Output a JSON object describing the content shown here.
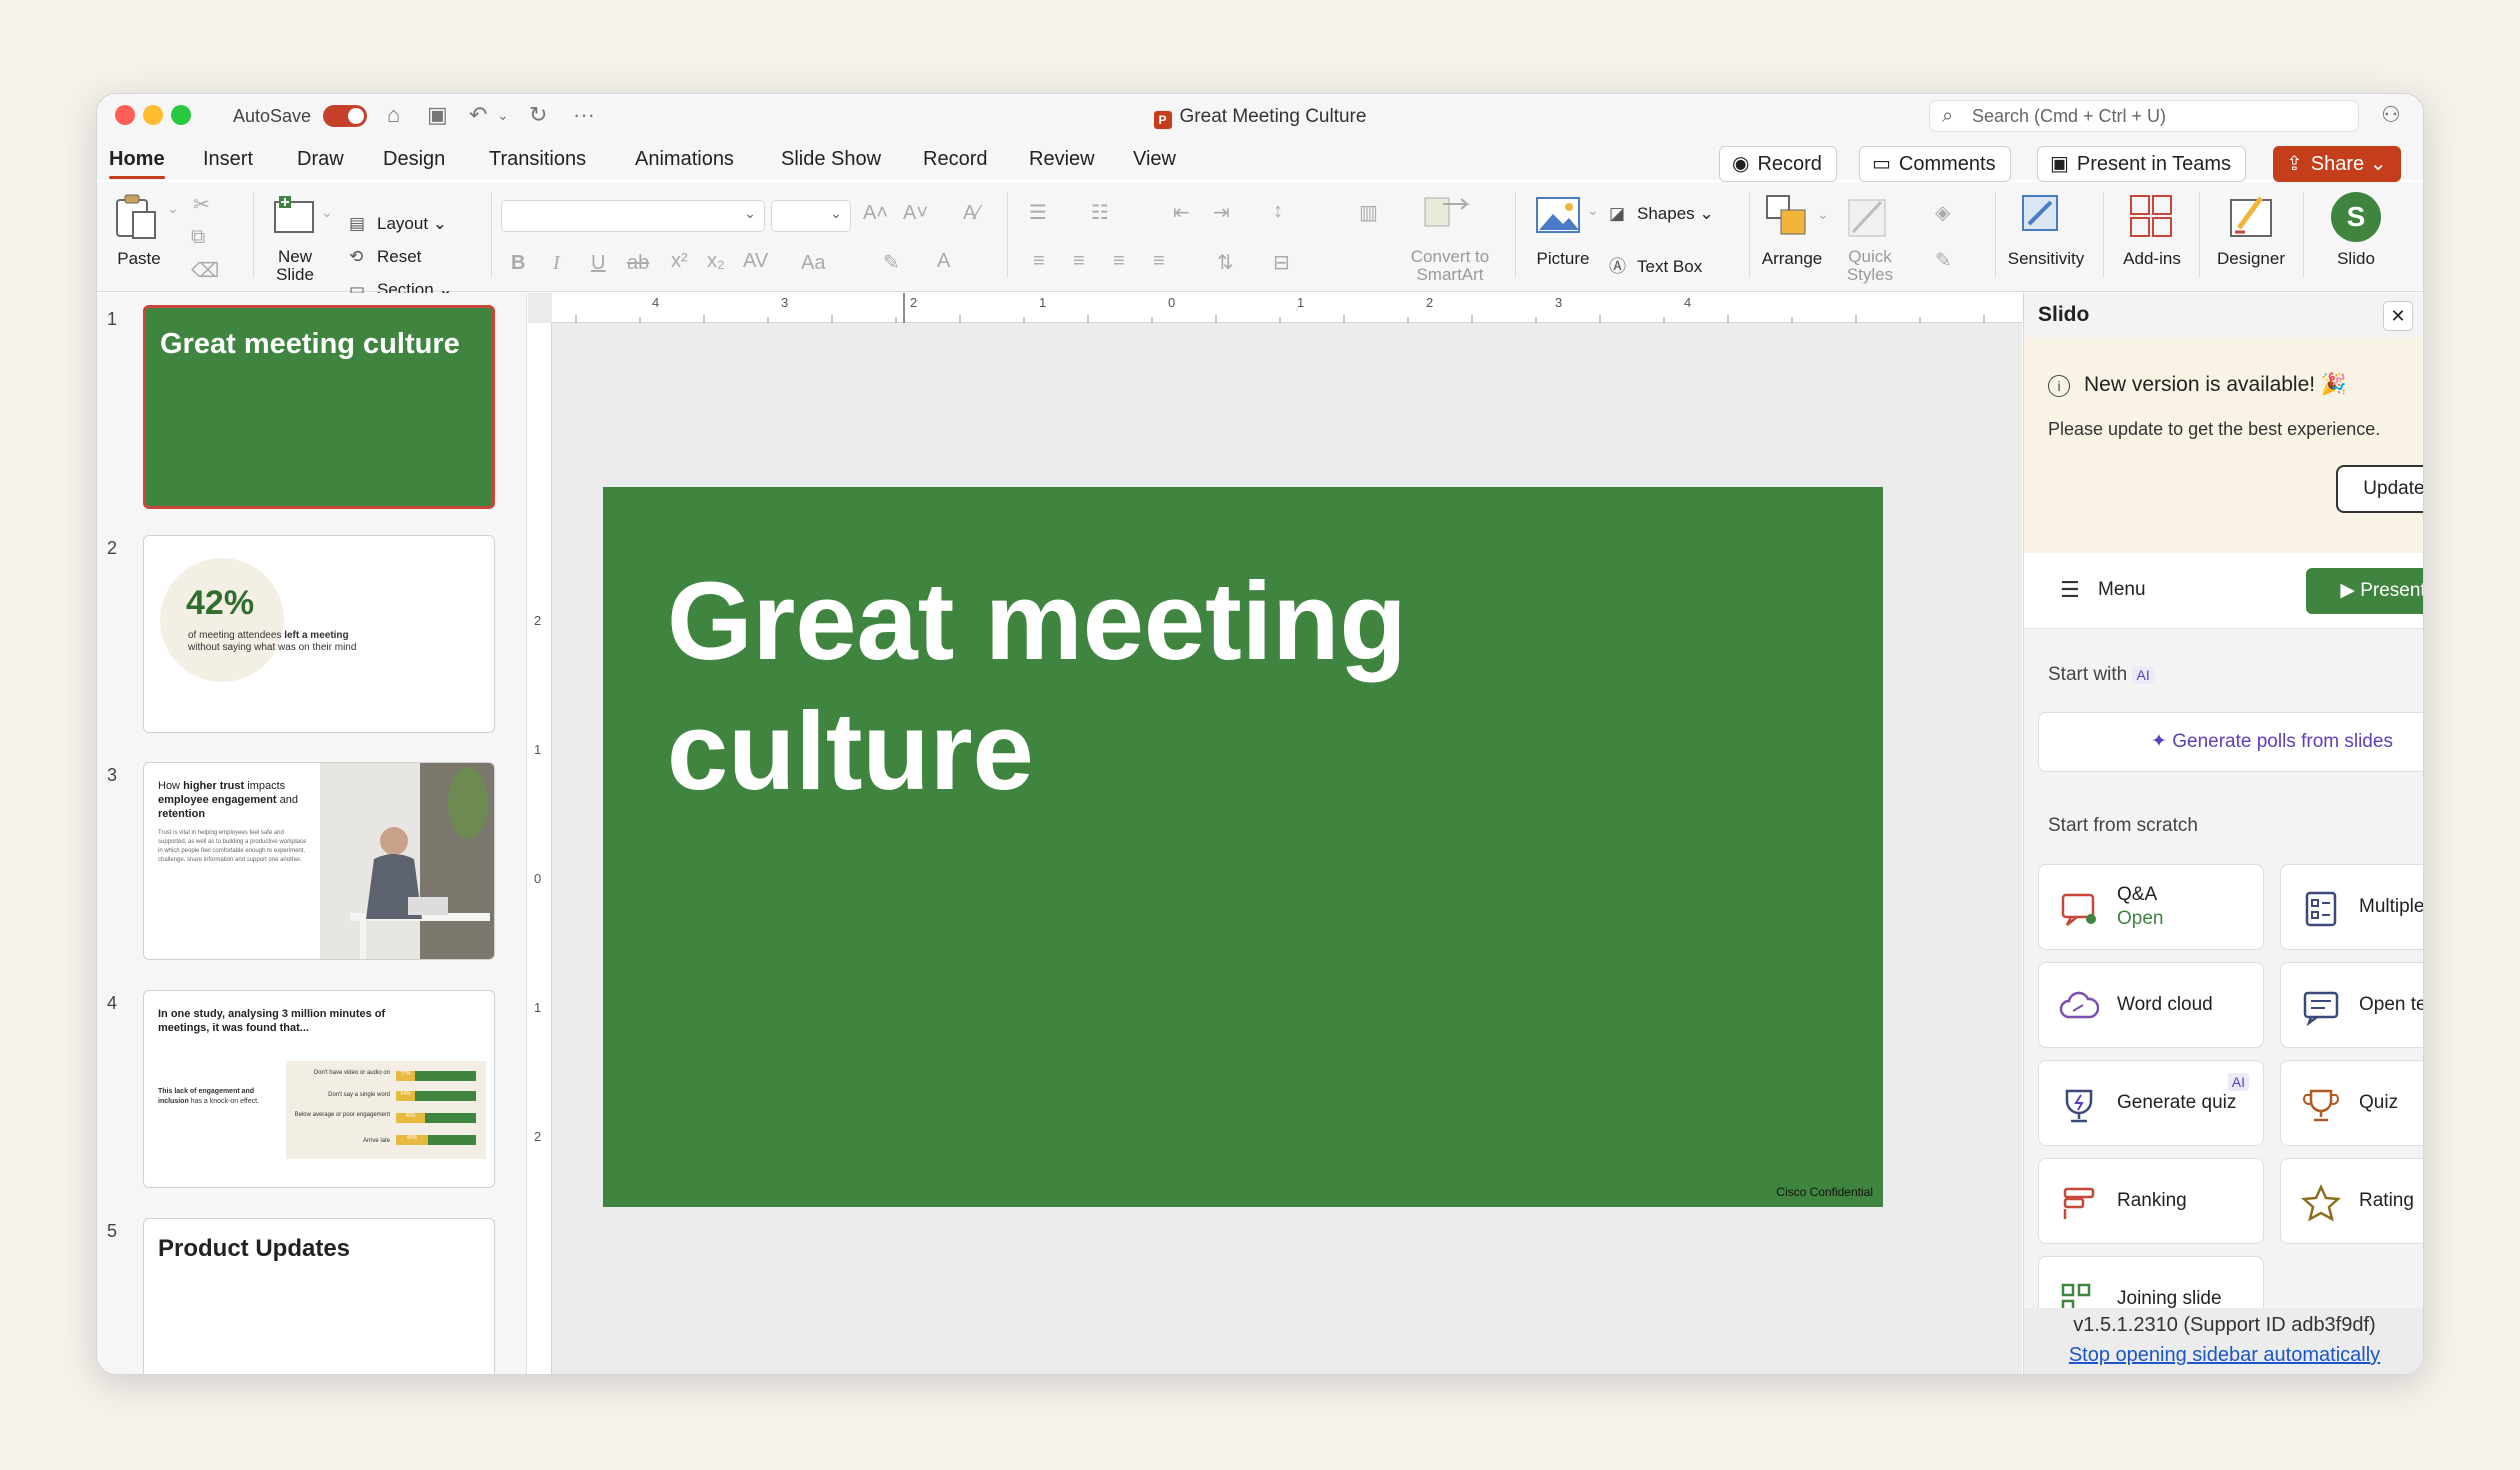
{
  "titlebar": {
    "autosave_label": "AutoSave",
    "document_title": "Great Meeting Culture",
    "search_placeholder": "Search (Cmd + Ctrl + U)"
  },
  "tabs": [
    "Home",
    "Insert",
    "Draw",
    "Design",
    "Transitions",
    "Animations",
    "Slide Show",
    "Record",
    "Review",
    "View"
  ],
  "actions": {
    "record": "Record",
    "comments": "Comments",
    "present_in_teams": "Present in Teams",
    "share": "Share"
  },
  "ribbon": {
    "paste": "Paste",
    "new_slide": "New\nSlide",
    "layout": "Layout",
    "reset": "Reset",
    "section": "Section",
    "convert_to_smartart": "Convert to\nSmartArt",
    "picture": "Picture",
    "shapes": "Shapes",
    "text_box": "Text Box",
    "arrange": "Arrange",
    "quick_styles": "Quick\nStyles",
    "sensitivity": "Sensitivity",
    "add_ins": "Add-ins",
    "designer": "Designer",
    "slido": "Slido",
    "slido_letter": "S"
  },
  "ruler": {
    "h_labels": [
      "4",
      "3",
      "2",
      "1",
      "0",
      "1",
      "2",
      "3",
      "4"
    ],
    "v_labels": [
      "2",
      "1",
      "0",
      "1",
      "2"
    ]
  },
  "thumbnails": [
    {
      "number": "1",
      "title": "Great meeting culture"
    },
    {
      "number": "2",
      "stat": "42%",
      "caption_pre": "of meeting attendees ",
      "caption_bold": "left a meeting",
      "caption_post": "without saying what was on their mind"
    },
    {
      "number": "3",
      "title_pre": "How ",
      "title_b1": "higher trust",
      "title_mid": " impacts ",
      "title_b2": "employee engagement",
      "title_mid2": " and ",
      "title_b3": "retention",
      "body": "Trust is vital in helping employees feel safe and supported, as well as to building a productive workplace in which people feel comfortable enough to experiment, challenge, share information and support one another."
    },
    {
      "number": "4",
      "title": "In one study, analysing 3 million minutes of meetings, it was found that...",
      "body_bold": "This lack of engagement and inclusion",
      "body_rest": " has a knock-on effect.",
      "bars": [
        {
          "label": "Don't have video or audio on",
          "value": "77%"
        },
        {
          "label": "Don't say a single word",
          "value": "54%"
        },
        {
          "label": "Below average or poor engagement",
          "value": "46%"
        },
        {
          "label": "Arrive late",
          "value": "40%"
        }
      ]
    },
    {
      "number": "5",
      "title": "Product Updates"
    }
  ],
  "slide": {
    "title": "Great meeting culture",
    "footer": "Cisco Confidential"
  },
  "slido": {
    "pane_title": "Slido",
    "notice_title": "New version is available! 🎉",
    "notice_body": "Please update to get the best experience.",
    "update_button": "Update now",
    "menu": "Menu",
    "present": "Present",
    "start_with": "Start with",
    "ai_badge": "AI",
    "generate_polls": "Generate polls from slides",
    "start_from_scratch": "Start from scratch",
    "cards": [
      {
        "label": "Q&A",
        "sub": "Open"
      },
      {
        "label": "Multiple choice"
      },
      {
        "label": "Word cloud"
      },
      {
        "label": "Open text"
      },
      {
        "label": "Generate quiz",
        "badge": "AI"
      },
      {
        "label": "Quiz"
      },
      {
        "label": "Ranking"
      },
      {
        "label": "Rating"
      },
      {
        "label": "Joining slide"
      }
    ],
    "version": "v1.5.1.2310 (Support ID adb3f9df)",
    "stop_link": "Stop opening sidebar automatically"
  }
}
